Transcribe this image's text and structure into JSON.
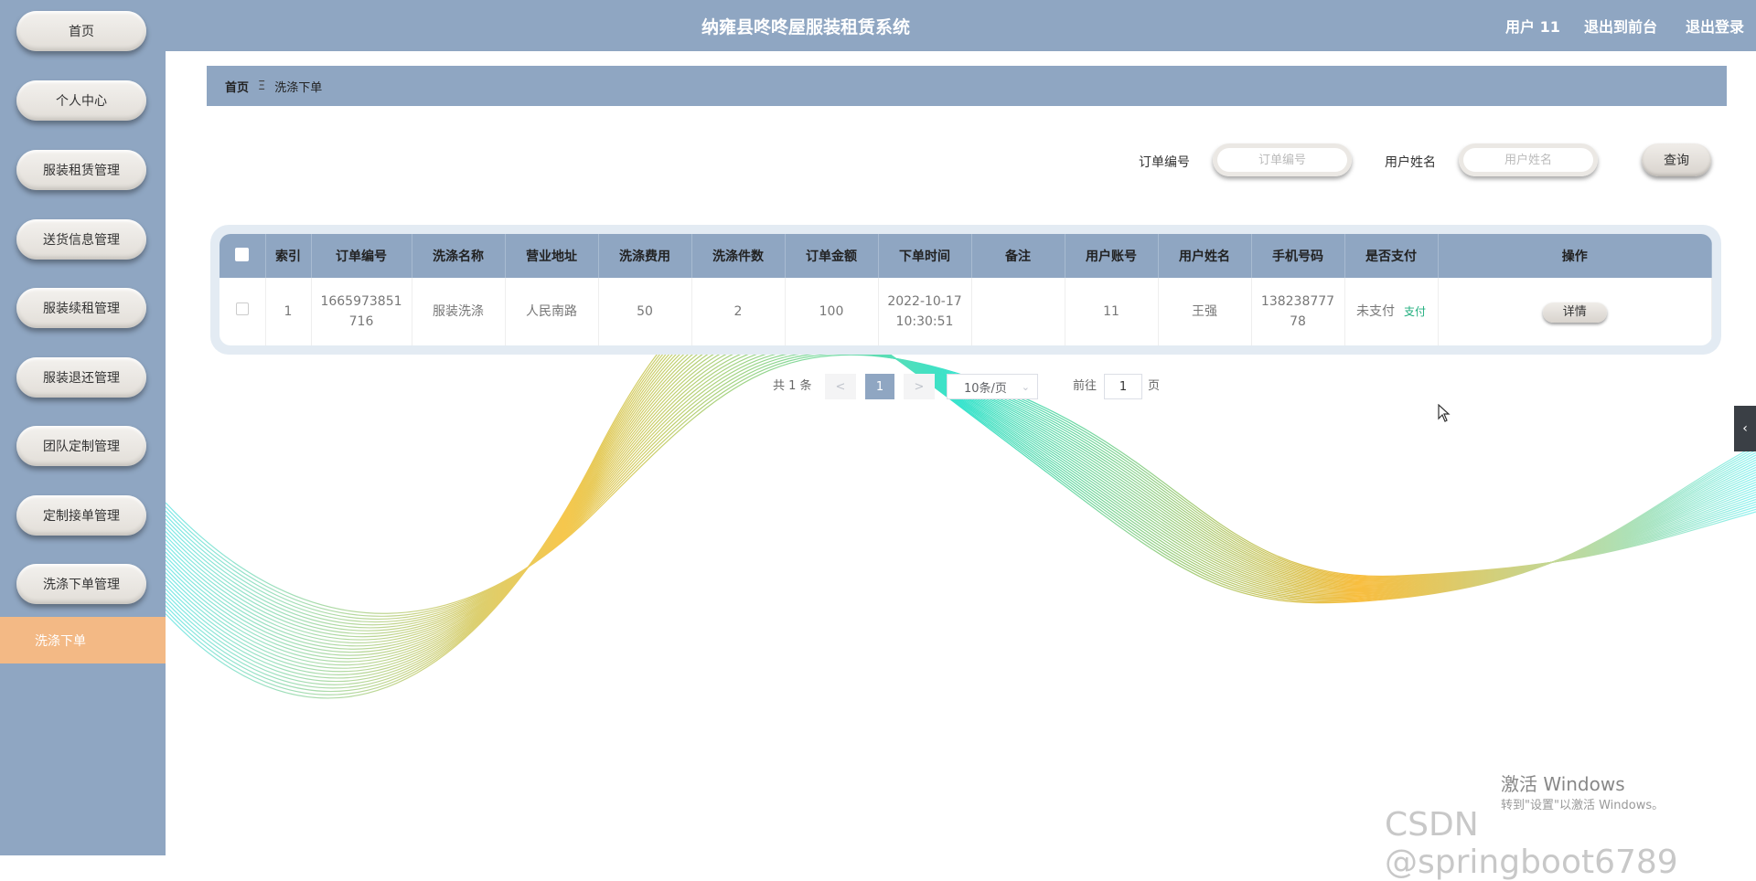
{
  "app": {
    "title": "纳雍县咚咚屋服装租赁系统",
    "user_label": "用户 11",
    "front_link": "退出到前台",
    "logout_link": "退出登录"
  },
  "sidebar": {
    "items": [
      {
        "label": "首页"
      },
      {
        "label": "个人中心"
      },
      {
        "label": "服装租赁管理"
      },
      {
        "label": "送货信息管理"
      },
      {
        "label": "服装续租管理"
      },
      {
        "label": "服装退还管理"
      },
      {
        "label": "团队定制管理"
      },
      {
        "label": "定制接单管理"
      },
      {
        "label": "洗涤下单管理"
      }
    ],
    "active_sub": "洗涤下单"
  },
  "breadcrumb": {
    "home": "首页",
    "separator": "Ξ",
    "current": "洗涤下单"
  },
  "search": {
    "order_no_label": "订单编号",
    "order_no_placeholder": "订单编号",
    "user_name_label": "用户姓名",
    "user_name_placeholder": "用户姓名",
    "query_button": "查询"
  },
  "table": {
    "headers": [
      "索引",
      "订单编号",
      "洗涤名称",
      "营业地址",
      "洗涤费用",
      "洗涤件数",
      "订单金额",
      "下单时间",
      "备注",
      "用户账号",
      "用户姓名",
      "手机号码",
      "是否支付",
      "操作"
    ],
    "rows": [
      {
        "index": "1",
        "order_no_1": "1665973851",
        "order_no_2": "716",
        "wash_name": "服装洗涤",
        "address": "人民南路",
        "wash_fee": "50",
        "wash_count": "2",
        "order_amount": "100",
        "order_date": "2022-10-17",
        "order_time": "10:30:51",
        "remark": "",
        "account": "11",
        "user_name": "王强",
        "phone_1": "138238777",
        "phone_2": "78",
        "paid_status": "未支付",
        "pay_link": "支付",
        "detail_button": "详情"
      }
    ]
  },
  "pagination": {
    "total": "共 1 条",
    "prev": "<",
    "current_page": "1",
    "next": ">",
    "page_size": "10条/页",
    "goto_label": "前往",
    "goto_value": "1",
    "page_unit": "页"
  },
  "side_toggle": "‹",
  "watermarks": {
    "activate_title": "激活 Windows",
    "activate_sub": "转到\"设置\"以激活 Windows。",
    "csdn": "CSDN @springboot6789"
  },
  "colors": {
    "primary": "#8fa6c2",
    "active_sub": "#f3b985",
    "pay_link": "#1fae7d"
  }
}
